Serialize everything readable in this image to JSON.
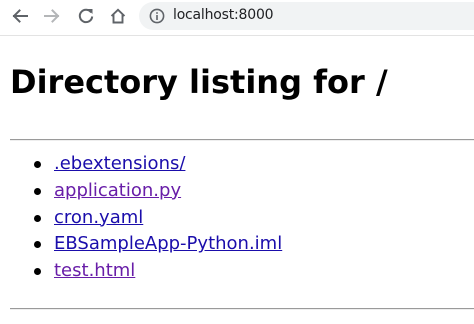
{
  "browser": {
    "back_icon": "arrow-left-icon",
    "forward_icon": "arrow-right-icon",
    "reload_icon": "reload-icon",
    "home_icon": "home-icon",
    "info_icon": "info-icon",
    "url": "localhost:8000"
  },
  "page": {
    "heading": "Directory listing for /",
    "entries": [
      {
        "name": ".ebextensions/",
        "visited": false
      },
      {
        "name": "application.py",
        "visited": true
      },
      {
        "name": "cron.yaml",
        "visited": false
      },
      {
        "name": "EBSampleApp-Python.iml",
        "visited": false
      },
      {
        "name": "test.html",
        "visited": true
      }
    ]
  },
  "colors": {
    "link": "#1a0dab",
    "visited_link": "#681da8",
    "omnibox_bg": "#f1f3f4",
    "rule": "#9a9a9a"
  }
}
